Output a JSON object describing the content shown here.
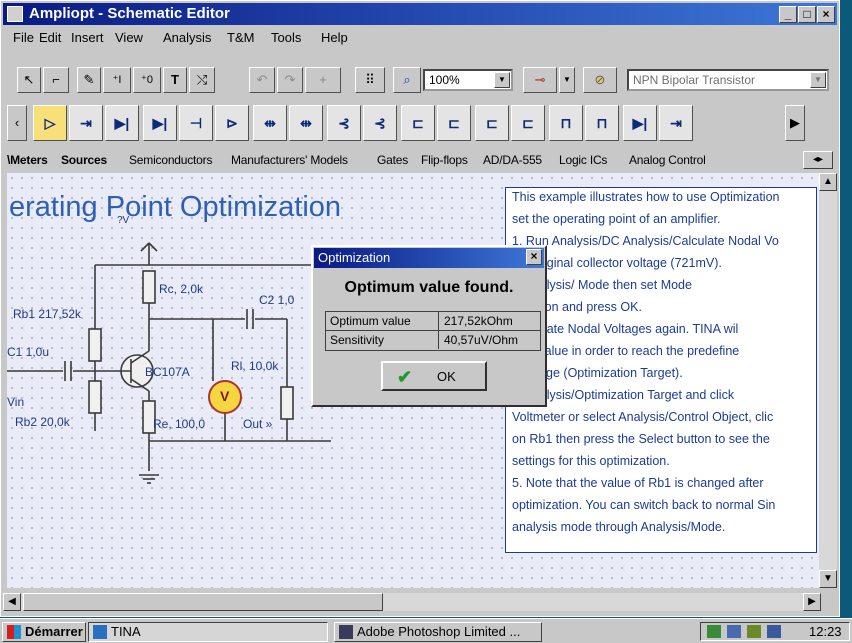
{
  "window": {
    "title": "Ampliopt - Schematic Editor",
    "minimize": "_",
    "maximize": "□",
    "close": "×"
  },
  "menu": [
    "File",
    "Edit",
    "Insert",
    "View",
    "Analysis",
    "T&M",
    "Tools",
    "Help"
  ],
  "toolbar": {
    "zoom_value": "100%",
    "component_value": "NPN Bipolar Transistor"
  },
  "tabs": [
    "\\Meters",
    "Sources",
    "Semiconductors",
    "Manufacturers' Models",
    "Gates",
    "Flip-flops",
    "AD/DA-555",
    "Logic ICs",
    "Analog Control"
  ],
  "canvas": {
    "heading": "erating Point Optimization",
    "qv": "?V",
    "labels": {
      "rc": "Rc, 2,0k",
      "c2": "C2 1,0",
      "rb1": "Rb1 217,52k",
      "c1": "C1 1,0u",
      "bc": "BC107A",
      "rl": "Rl, 10,0k",
      "vin": "Vin",
      "rb2": "Rb2 20,0k",
      "re": "Re, 100,0",
      "out": "Out »",
      "meter": "V"
    }
  },
  "note": {
    "lines": [
      "This example illustrates how to use Optimization",
      "set the operating point of an amplifier.",
      "1. Run Analysis/DC Analysis/Calculate Nodal Vo",
      "the original collector voltage (721mV).",
      "ct Analysis/ Mode then set Mode",
      "mization and press OK.",
      "Calculate Nodal Voltages again. TINA wil",
      "Rb1 value in order to reach the predefine",
      "r voltage (Optimization Target).",
      "ct Analysis/Optimization Target and click",
      "Voltmeter or select Analysis/Control Object, clic",
      "on Rb1 then press the Select button to see the",
      "settings for this optimization.",
      "5. Note that the value of Rb1 is changed after",
      "optimization. You can switch back to normal Sin",
      "analysis mode through Analysis/Mode."
    ]
  },
  "dialog": {
    "title": "Optimization",
    "close": "×",
    "message": "Optimum value found.",
    "rows": [
      {
        "label": "Optimum value",
        "value": "217,52kOhm"
      },
      {
        "label": "Sensitivity",
        "value": "40,57uV/Ohm"
      }
    ],
    "ok_label": "OK"
  },
  "taskbar": {
    "start": "Démarrer",
    "items": [
      "TINA",
      "Adobe Photoshop Limited ..."
    ],
    "clock": "12:23"
  }
}
